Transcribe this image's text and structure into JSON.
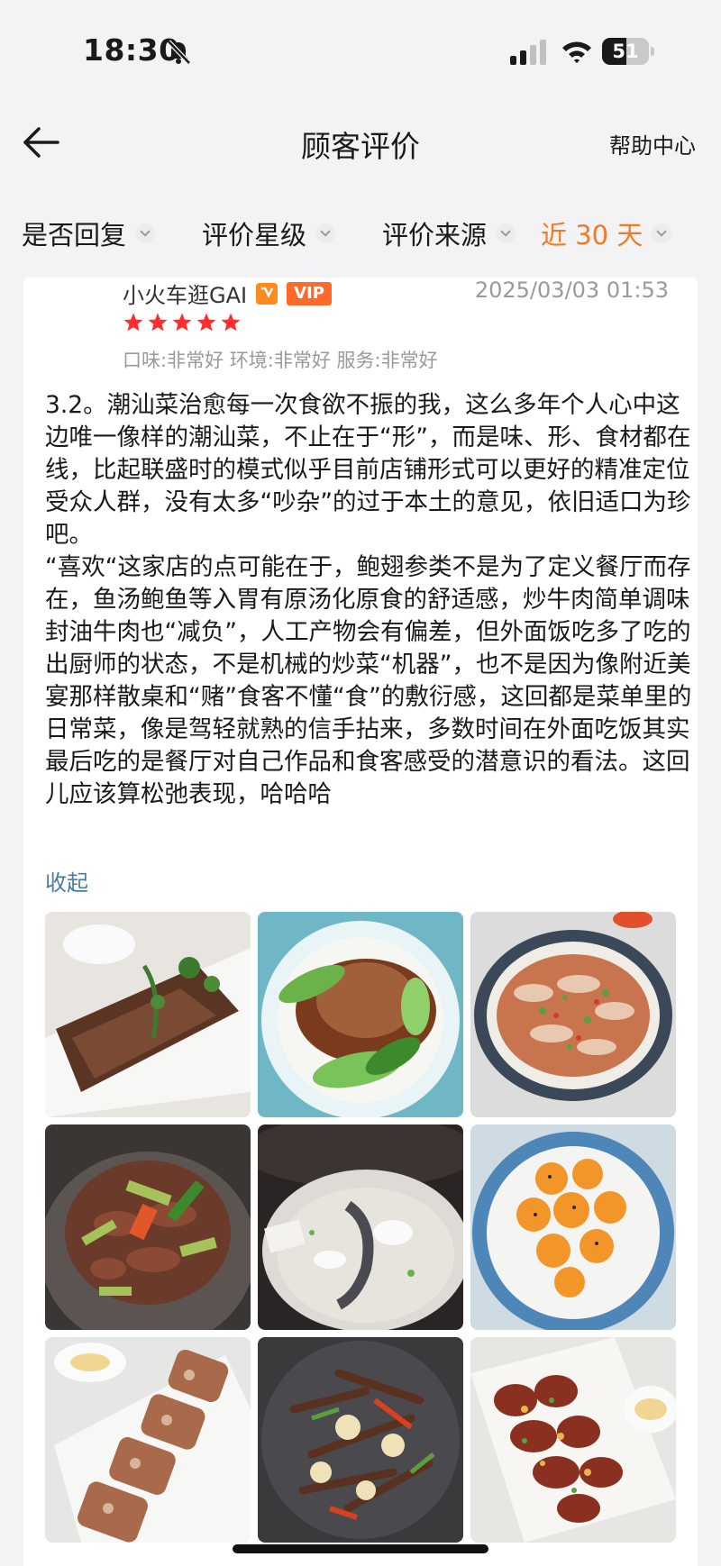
{
  "status_bar": {
    "time": "18:30",
    "battery_level": "51",
    "battery_fraction": 0.51,
    "icons": [
      "bell-muted-icon",
      "cellular-signal-icon",
      "wifi-icon",
      "battery-icon"
    ]
  },
  "nav": {
    "back_icon": "back-arrow-icon",
    "title": "顾客评价",
    "help_label": "帮助中心"
  },
  "filters": [
    {
      "label": "是否回复",
      "active": false
    },
    {
      "label": "评价星级",
      "active": false
    },
    {
      "label": "评价来源",
      "active": false
    },
    {
      "label": "近 30 天",
      "active": true
    }
  ],
  "colors": {
    "accent": "#f47a1f",
    "star": "#ff2d2d",
    "vip": "#ff6a2a",
    "link": "#4a7aa7"
  },
  "review": {
    "user_name": "小火车逛GAI",
    "level_badge": "",
    "vip_badge": "VIP",
    "date": "2025/03/03 01:53",
    "rating": 5,
    "rating_max": 5,
    "sub_scores": "口味:非常好 环境:非常好 服务:非常好",
    "paragraph1": "3.2。潮汕菜治愈每一次食欲不振的我，这么多年个人心中这边唯一像样的潮汕菜，不止在于“形”，而是味、形、食材都在线，比起联盛时的模式似乎目前店铺形式可以更好的精准定位受众人群，没有太多“吵杂”的过于本土的意见，依旧适口为珍吧。",
    "paragraph2": "“喜欢“这家店的点可能在于，鲍翅参类不是为了定义餐厅而存在，鱼汤鲍鱼等入胃有原汤化原食的舒适感，炒牛肉简单调味封油牛肉也“减负”，人工产物会有偏差，但外面饭吃多了吃的出厨师的状态，不是机械的炒菜“机器”，也不是因为像附近美宴那样散桌和“赌”食客不懂“食”的敷衍感，这回都是菜单里的日常菜，像是驾轻就熟的信手拈来，多数时间在外面吃饭其实最后吃的是餐厅对自己作品和食客感受的潜意识的看法。这回儿应该算松弛表现，哈哈哈",
    "collapse_label": "收起",
    "photos": [
      "braised-goose-slices-photo",
      "braised-abalone-bok-choy-photo",
      "marinated-crab-photo",
      "stir-fried-beef-greens-photo",
      "fish-soup-photo",
      "fried-shrimp-balls-photo",
      "crispy-rolls-photo",
      "stir-fried-mushrooms-photo",
      "fried-pork-bites-photo"
    ]
  }
}
